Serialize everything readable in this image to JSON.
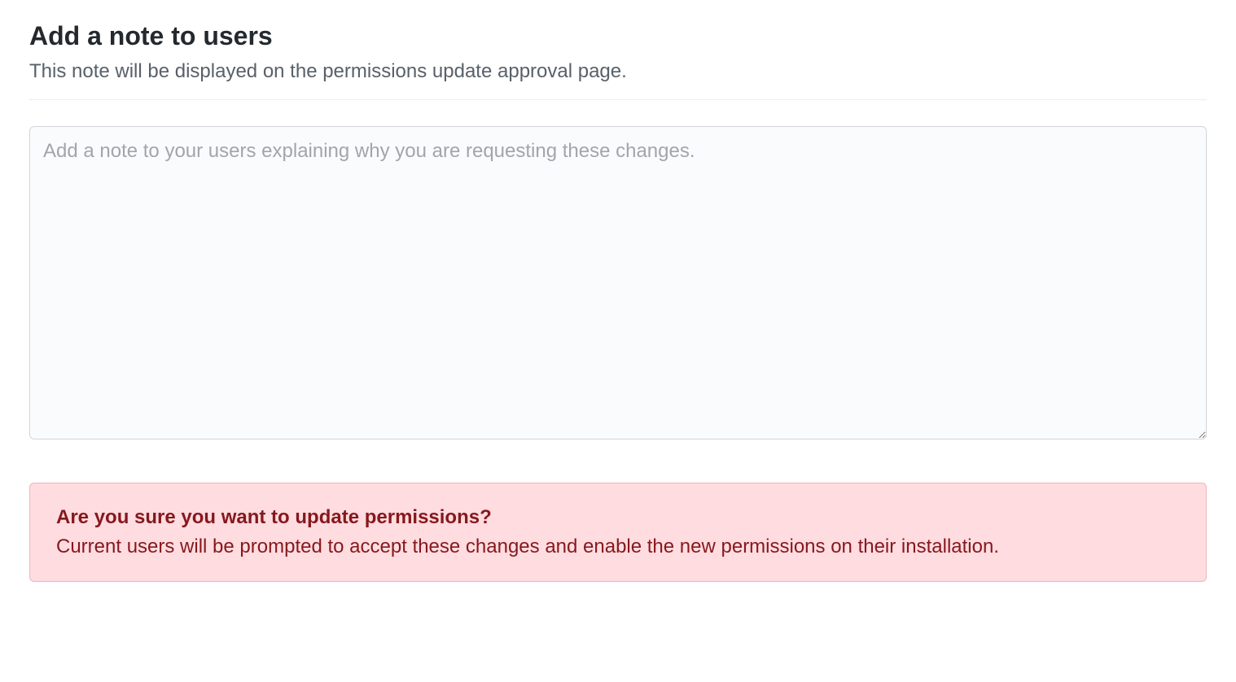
{
  "header": {
    "title": "Add a note to users",
    "subtitle": "This note will be displayed on the permissions update approval page."
  },
  "note_input": {
    "placeholder": "Add a note to your users explaining why you are requesting these changes.",
    "value": ""
  },
  "warning": {
    "title": "Are you sure you want to update permissions?",
    "body": "Current users will be prompted to accept these changes and enable the new permissions on their installation."
  }
}
